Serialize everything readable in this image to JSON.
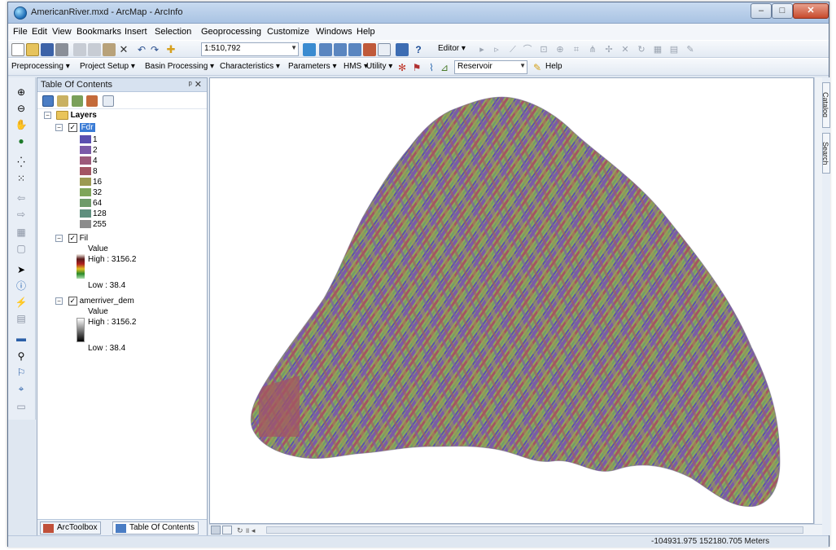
{
  "window": {
    "title": "AmericanRiver.mxd - ArcMap - ArcInfo",
    "controls": {
      "minimize": "–",
      "maximize": "□",
      "close": "✕"
    }
  },
  "menubar": [
    "File",
    "Edit",
    "View",
    "Bookmarks",
    "Insert",
    "Selection",
    "Geoprocessing",
    "Customize",
    "Windows",
    "Help"
  ],
  "standard_toolbar": {
    "scale": "1:510,792",
    "editor_label": "Editor ▾"
  },
  "hydro_toolbar": {
    "menus": [
      "Preprocessing ▾",
      "Project Setup ▾",
      "Basin Processing ▾",
      "Characteristics ▾",
      "Parameters ▾",
      "HMS ▾",
      "Utility ▾"
    ],
    "reservoir_value": "Reservoir",
    "help_label": "Help"
  },
  "toc": {
    "title": "Table Of Contents",
    "pin": "ᵖ ✕",
    "root": "Layers",
    "layers": [
      {
        "name": "Fdr",
        "checked": true,
        "classes": [
          {
            "label": "1",
            "color": "#5a4fb0"
          },
          {
            "label": "2",
            "color": "#7b5aa8"
          },
          {
            "label": "4",
            "color": "#9c5a7a"
          },
          {
            "label": "8",
            "color": "#a35563"
          },
          {
            "label": "16",
            "color": "#9c9a52"
          },
          {
            "label": "32",
            "color": "#7fa55a"
          },
          {
            "label": "64",
            "color": "#6e9b6a"
          },
          {
            "label": "128",
            "color": "#5e8f7e"
          },
          {
            "label": "255",
            "color": "#8c8c8c"
          }
        ]
      },
      {
        "name": "Fil",
        "checked": true,
        "value_label": "Value",
        "high": "High : 3156.2",
        "low": "Low : 38.4"
      },
      {
        "name": "amerriver_dem",
        "checked": true,
        "value_label": "Value",
        "high": "High : 3156.2",
        "low": "Low : 38.4"
      }
    ],
    "tabs": {
      "arctoolbox": "ArcToolbox",
      "toc": "Table Of Contents"
    }
  },
  "dock_tabs": {
    "catalog": "Catalog",
    "search": "Search"
  },
  "status": {
    "coords": "-104931.975 152180.705 Meters"
  },
  "colors": {
    "title_bar": "#a9c3e3",
    "selection": "#3a7bd5",
    "map_purple": "#7b5aa8",
    "map_green": "#8fa85a",
    "map_red": "#a35563"
  }
}
